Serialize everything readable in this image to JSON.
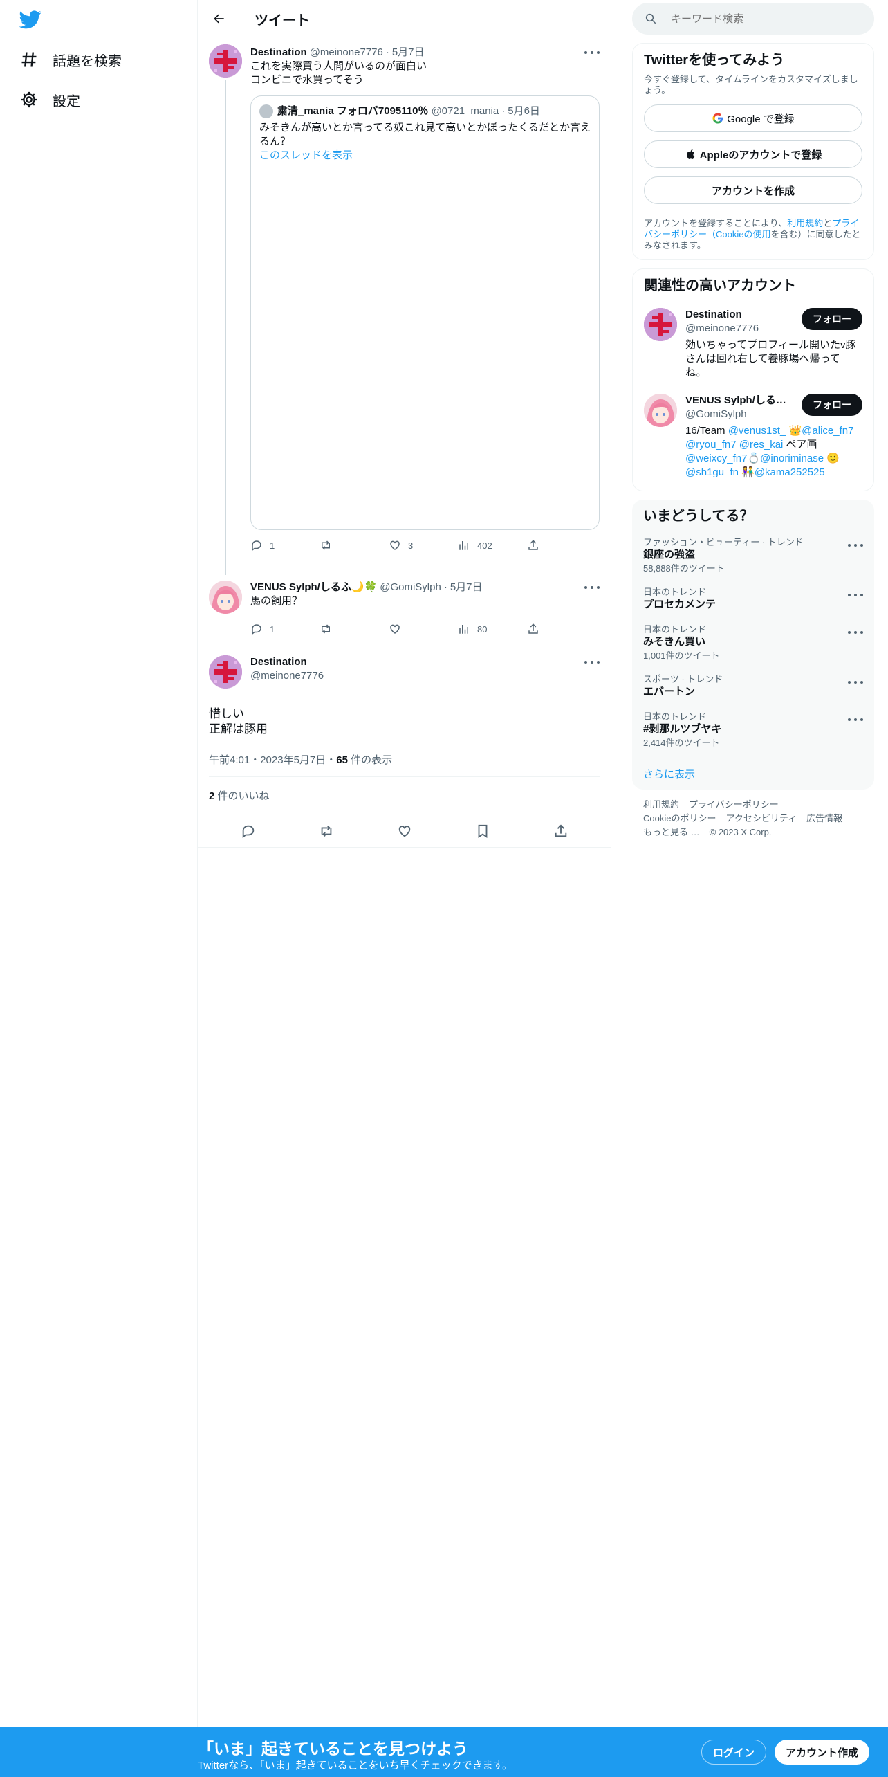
{
  "colors": {
    "brand": "#1d9bf0",
    "text": "#0f1419",
    "secondary": "#536471",
    "follow_button": "#0f1419"
  },
  "sidebar": {
    "logo_icon": "twitter-bird-icon",
    "items": [
      {
        "label": "話題を検索",
        "icon": "hashtag-icon"
      },
      {
        "label": "設定",
        "icon": "gear-icon"
      }
    ]
  },
  "header": {
    "title": "ツイート"
  },
  "tweets": [
    {
      "name": "Destination",
      "handle": "@meinone7776",
      "date": "5月7日",
      "text": "これを実際買う人間がいるのが面白い\nコンビニで水買ってそう",
      "quote": {
        "name": "粛清_mania フォロバ7095110％",
        "handle": "@0721_mania",
        "date": "5月6日",
        "text": "みそきんが高いとか言ってる奴これ見て高いとかぼったくるだとか言えるん？",
        "link": "このスレッドを表示"
      },
      "actions": {
        "replies": "1",
        "retweets": "",
        "likes": "3",
        "views": "402"
      }
    },
    {
      "name": "VENUS Sylph/しるふ🌙🍀",
      "handle": "@GomiSylph",
      "date": "5月7日",
      "text": "馬の飼用？",
      "actions": {
        "replies": "1",
        "retweets": "",
        "likes": "",
        "views": "80"
      }
    }
  ],
  "focus": {
    "name": "Destination",
    "handle": "@meinone7776",
    "text": "惜しい\n正解は豚用",
    "time": "午前4:01・2023年5月7日・",
    "views_count": "65",
    "views_label": " 件の表示",
    "likes_count": "2",
    "likes_label": " 件のいいね"
  },
  "right": {
    "search_placeholder": "キーワード検索",
    "signup": {
      "title": "Twitterを使ってみよう",
      "subtitle": "今すぐ登録して、タイムラインをカスタマイズしましょう。",
      "google": "Google で登録",
      "apple": "Appleのアカウントで登録",
      "create": "アカウントを作成",
      "tos_1": "アカウントを登録することにより、",
      "tos_link_1": "利用規約",
      "tos_2": "と",
      "tos_link_2": "プライバシーポリシー（Cookieの使用",
      "tos_3": "を含む）に同意したとみなされます。"
    },
    "related": {
      "title": "関連性の高いアカウント",
      "follow_label": "フォロー",
      "accounts": [
        {
          "name": "Destination",
          "handle": "@meinone7776",
          "bio": "効いちゃってプロフィール開いたv豚さんは回れ右して養豚場へ帰ってね。"
        },
        {
          "name": "VENUS Sylph/しるふ🌙🍀",
          "handle": "@GomiSylph",
          "bio_a": "16/Team ",
          "bio_l1": "@venus1st_",
          "bio_b": " 👑",
          "bio_l2": "@alice_fn7",
          "bio_l3": "@ryou_fn7",
          "bio_l4": "@res_kai",
          "bio_c": " ペア画 ",
          "bio_l5": "@weixcy_fn7",
          "bio_d": "💍",
          "bio_l6": "@inoriminase",
          "bio_e": " 🙂 ",
          "bio_l7": "@sh1gu_fn",
          "bio_f": " 👫",
          "bio_l8": "@kama252525"
        }
      ]
    },
    "trends": {
      "title": "いまどうしてる？",
      "items": [
        {
          "meta": "ファッション・ビューティー · トレンド",
          "name": "銀座の強盗",
          "count": "58,888件のツイート"
        },
        {
          "meta": "日本のトレンド",
          "name": "プロセカメンテ",
          "count": ""
        },
        {
          "meta": "日本のトレンド",
          "name": "みそきん買い",
          "count": "1,001件のツイート"
        },
        {
          "meta": "スポーツ · トレンド",
          "name": "エバートン",
          "count": ""
        },
        {
          "meta": "日本のトレンド",
          "name": "#剥那ルツブヤキ",
          "count": "2,414件のツイート"
        }
      ],
      "show_more": "さらに表示"
    },
    "footer": {
      "links": [
        "利用規約",
        "プライバシーポリシー",
        "Cookieのポリシー",
        "アクセシビリティ",
        "広告情報",
        "もっと見る …"
      ],
      "copyright": "© 2023 X Corp."
    }
  },
  "banner": {
    "title": "「いま」起きていることを見つけよう",
    "subtitle": "Twitterなら、「いま」起きていることをいち早くチェックできます。",
    "login": "ログイン",
    "create": "アカウント作成"
  }
}
